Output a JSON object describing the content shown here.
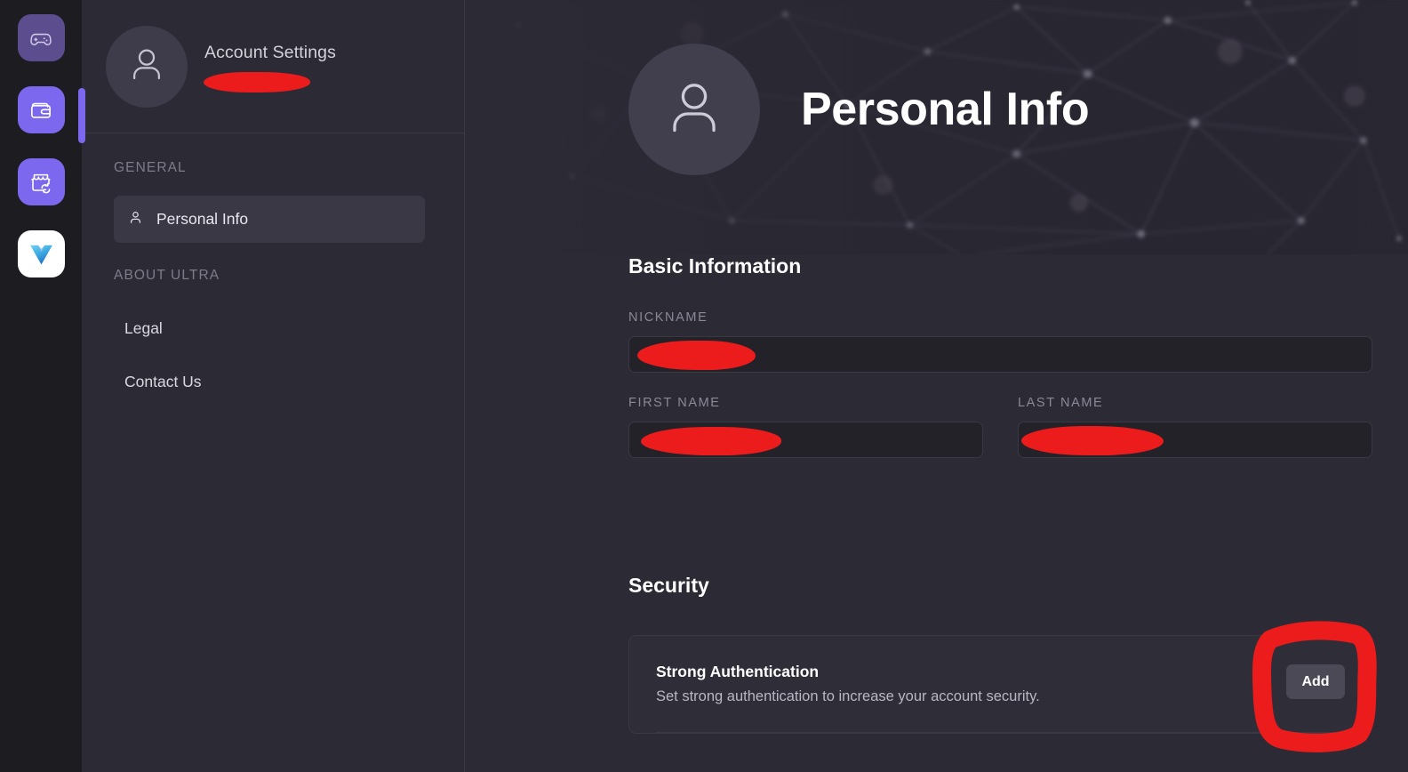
{
  "rail": {
    "items": [
      {
        "name": "games",
        "icon": "gamepad-icon",
        "active": false
      },
      {
        "name": "wallet",
        "icon": "wallet-icon",
        "active": true
      },
      {
        "name": "marketplace",
        "icon": "storefront-resale-icon",
        "active": false
      },
      {
        "name": "ultra",
        "icon": "ultra-logo-icon",
        "active": false
      }
    ]
  },
  "sidebar": {
    "header": {
      "title": "Account Settings",
      "username_redacted": true,
      "avatar_icon": "user-avatar-icon"
    },
    "sections": [
      {
        "label": "GENERAL",
        "items": [
          {
            "label": "Personal Info",
            "icon": "user-icon",
            "active": true
          }
        ]
      },
      {
        "label": "ABOUT ULTRA",
        "items": [
          {
            "label": "Legal",
            "active": false
          },
          {
            "label": "Contact Us",
            "active": false
          }
        ]
      }
    ]
  },
  "main": {
    "hero": {
      "title": "Personal Info",
      "avatar_icon": "user-avatar-icon"
    },
    "basic_information": {
      "section_title": "Basic Information",
      "fields": [
        {
          "label": "NICKNAME",
          "value_redacted": true
        },
        {
          "label": "FIRST NAME",
          "value_redacted": true
        },
        {
          "label": "LAST NAME",
          "value_redacted": true
        }
      ]
    },
    "security": {
      "section_title": "Security",
      "items": [
        {
          "title": "Strong Authentication",
          "description": "Set strong authentication to increase your account security.",
          "action_label": "Add"
        }
      ]
    }
  },
  "annotations": {
    "color": "#ed1c1c",
    "shapes": [
      {
        "type": "rectangle-scribble",
        "target": "add-button"
      },
      {
        "type": "redaction-scribble",
        "target": "sidebar-username"
      },
      {
        "type": "redaction-scribble",
        "target": "nickname-input"
      },
      {
        "type": "redaction-scribble",
        "target": "first-name-input"
      },
      {
        "type": "redaction-scribble",
        "target": "last-name-input"
      }
    ]
  },
  "colors": {
    "accent_purple": "#7c68ee",
    "annotation_red": "#ed1c1c",
    "panel_bg": "#2c2a35",
    "rail_bg": "#1d1c21",
    "input_bg": "#232229"
  }
}
